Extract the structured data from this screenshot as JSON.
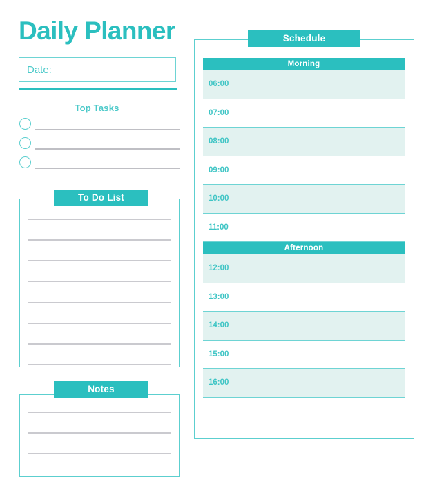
{
  "document": {
    "title": "Daily Planner"
  },
  "left": {
    "date_field": {
      "label": "Date:",
      "value": "",
      "placeholder": "Date:"
    },
    "top_tasks": {
      "title": "Top Tasks",
      "items": [
        "",
        "",
        ""
      ]
    },
    "todo": {
      "title": "To Do List",
      "line_count": 8,
      "items": [
        "",
        "",
        "",
        "",
        "",
        "",
        "",
        ""
      ]
    },
    "notes": {
      "title": "Notes",
      "line_count": 3,
      "items": [
        "",
        "",
        ""
      ]
    }
  },
  "schedule": {
    "title": "Schedule",
    "sections": [
      {
        "name": "Morning",
        "rows": [
          {
            "time": "06:00",
            "entry": "",
            "tinted": true
          },
          {
            "time": "07:00",
            "entry": "",
            "tinted": false
          },
          {
            "time": "08:00",
            "entry": "",
            "tinted": true
          },
          {
            "time": "09:00",
            "entry": "",
            "tinted": false
          },
          {
            "time": "10:00",
            "entry": "",
            "tinted": true
          },
          {
            "time": "11:00",
            "entry": "",
            "tinted": false
          }
        ]
      },
      {
        "name": "Afternoon",
        "rows": [
          {
            "time": "12:00",
            "entry": "",
            "tinted": true
          },
          {
            "time": "13:00",
            "entry": "",
            "tinted": false
          },
          {
            "time": "14:00",
            "entry": "",
            "tinted": true
          },
          {
            "time": "15:00",
            "entry": "",
            "tinted": false
          },
          {
            "time": "16:00",
            "entry": "",
            "tinted": true
          }
        ]
      }
    ]
  },
  "colors": {
    "accent": "#2BBFBF",
    "accent_light": "#5CCFCF",
    "row_tint": "#E2F2F0",
    "rule_gray": "#CACACF",
    "text_on_accent": "#FFFFFF"
  }
}
